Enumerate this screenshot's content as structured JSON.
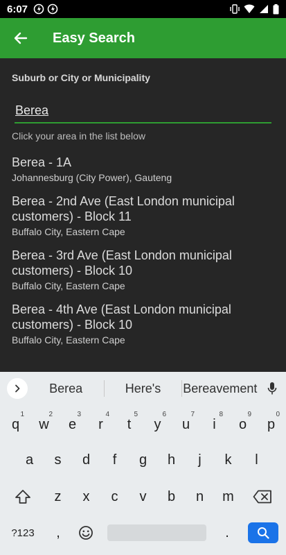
{
  "status_bar": {
    "time": "6:07"
  },
  "app_bar": {
    "title": "Easy Search"
  },
  "form": {
    "label": "Suburb or City or Municipality",
    "search_value": "Berea",
    "hint": "Click your area in the list below"
  },
  "results": [
    {
      "title": "Berea - 1A",
      "subtitle": "Johannesburg (City Power), Gauteng"
    },
    {
      "title": "Berea - 2nd Ave (East London municipal customers) - Block 11",
      "subtitle": "Buffalo City, Eastern Cape"
    },
    {
      "title": "Berea - 3rd Ave (East London municipal customers) - Block 10",
      "subtitle": "Buffalo City, Eastern Cape"
    },
    {
      "title": "Berea - 4th Ave (East London municipal customers) - Block 10",
      "subtitle": "Buffalo City, Eastern Cape"
    }
  ],
  "keyboard": {
    "suggestions": [
      "Berea",
      "Here's",
      "Bereavement"
    ],
    "row1": [
      {
        "k": "q",
        "n": "1"
      },
      {
        "k": "w",
        "n": "2"
      },
      {
        "k": "e",
        "n": "3"
      },
      {
        "k": "r",
        "n": "4"
      },
      {
        "k": "t",
        "n": "5"
      },
      {
        "k": "y",
        "n": "6"
      },
      {
        "k": "u",
        "n": "7"
      },
      {
        "k": "i",
        "n": "8"
      },
      {
        "k": "o",
        "n": "9"
      },
      {
        "k": "p",
        "n": "0"
      }
    ],
    "row2": [
      "a",
      "s",
      "d",
      "f",
      "g",
      "h",
      "j",
      "k",
      "l"
    ],
    "row3": [
      "z",
      "x",
      "c",
      "v",
      "b",
      "n",
      "m"
    ],
    "symbols_label": "?123",
    "comma_label": ",",
    "period_label": "."
  },
  "colors": {
    "accent": "#2e9d32",
    "keyboard_action": "#1a73e8"
  }
}
